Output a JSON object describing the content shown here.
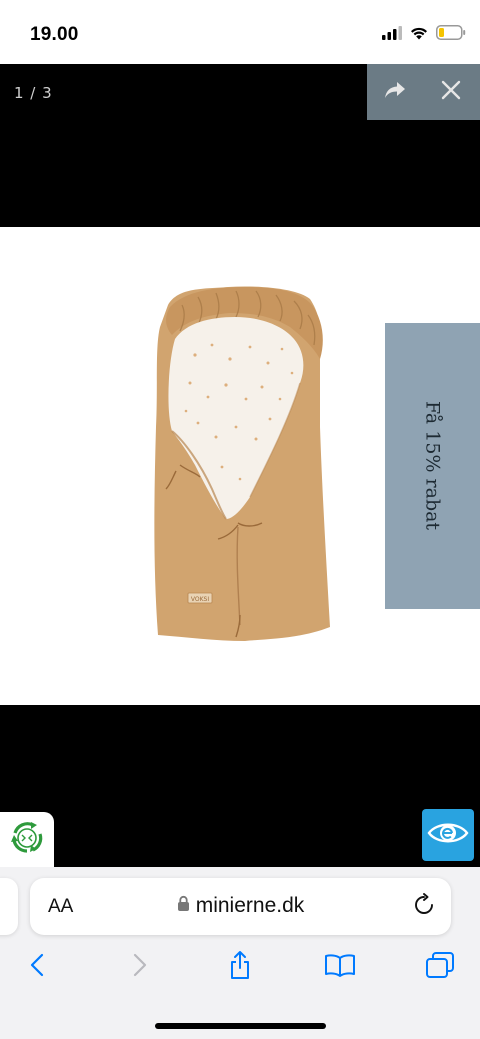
{
  "status_bar": {
    "time": "19.00",
    "icons": [
      "signal-icon",
      "wifi-icon",
      "battery-icon"
    ]
  },
  "lightbox": {
    "counter": "1 / 3",
    "actions": [
      {
        "name": "share-icon",
        "label": "share"
      },
      {
        "name": "close-icon",
        "label": "close"
      }
    ],
    "image_subject": "tan baby sleeping bag with white patterned lining",
    "image_brand_tag": "VOKSI"
  },
  "promo": {
    "discount_label": "Få 15% rabat",
    "background": "#8fa3b3"
  },
  "badges": {
    "left_icon": "recycle-icon",
    "right_icon": "eye-icon",
    "right_color": "#29a3e0"
  },
  "browser": {
    "text_size_label": "AA",
    "domain": "minierne.dk",
    "lock_icon": "lock-icon",
    "reload_icon": "reload-icon",
    "toolbar": [
      "back-icon",
      "forward-icon",
      "share-icon",
      "bookmarks-icon",
      "tabs-icon"
    ],
    "accent": "#007aff"
  }
}
